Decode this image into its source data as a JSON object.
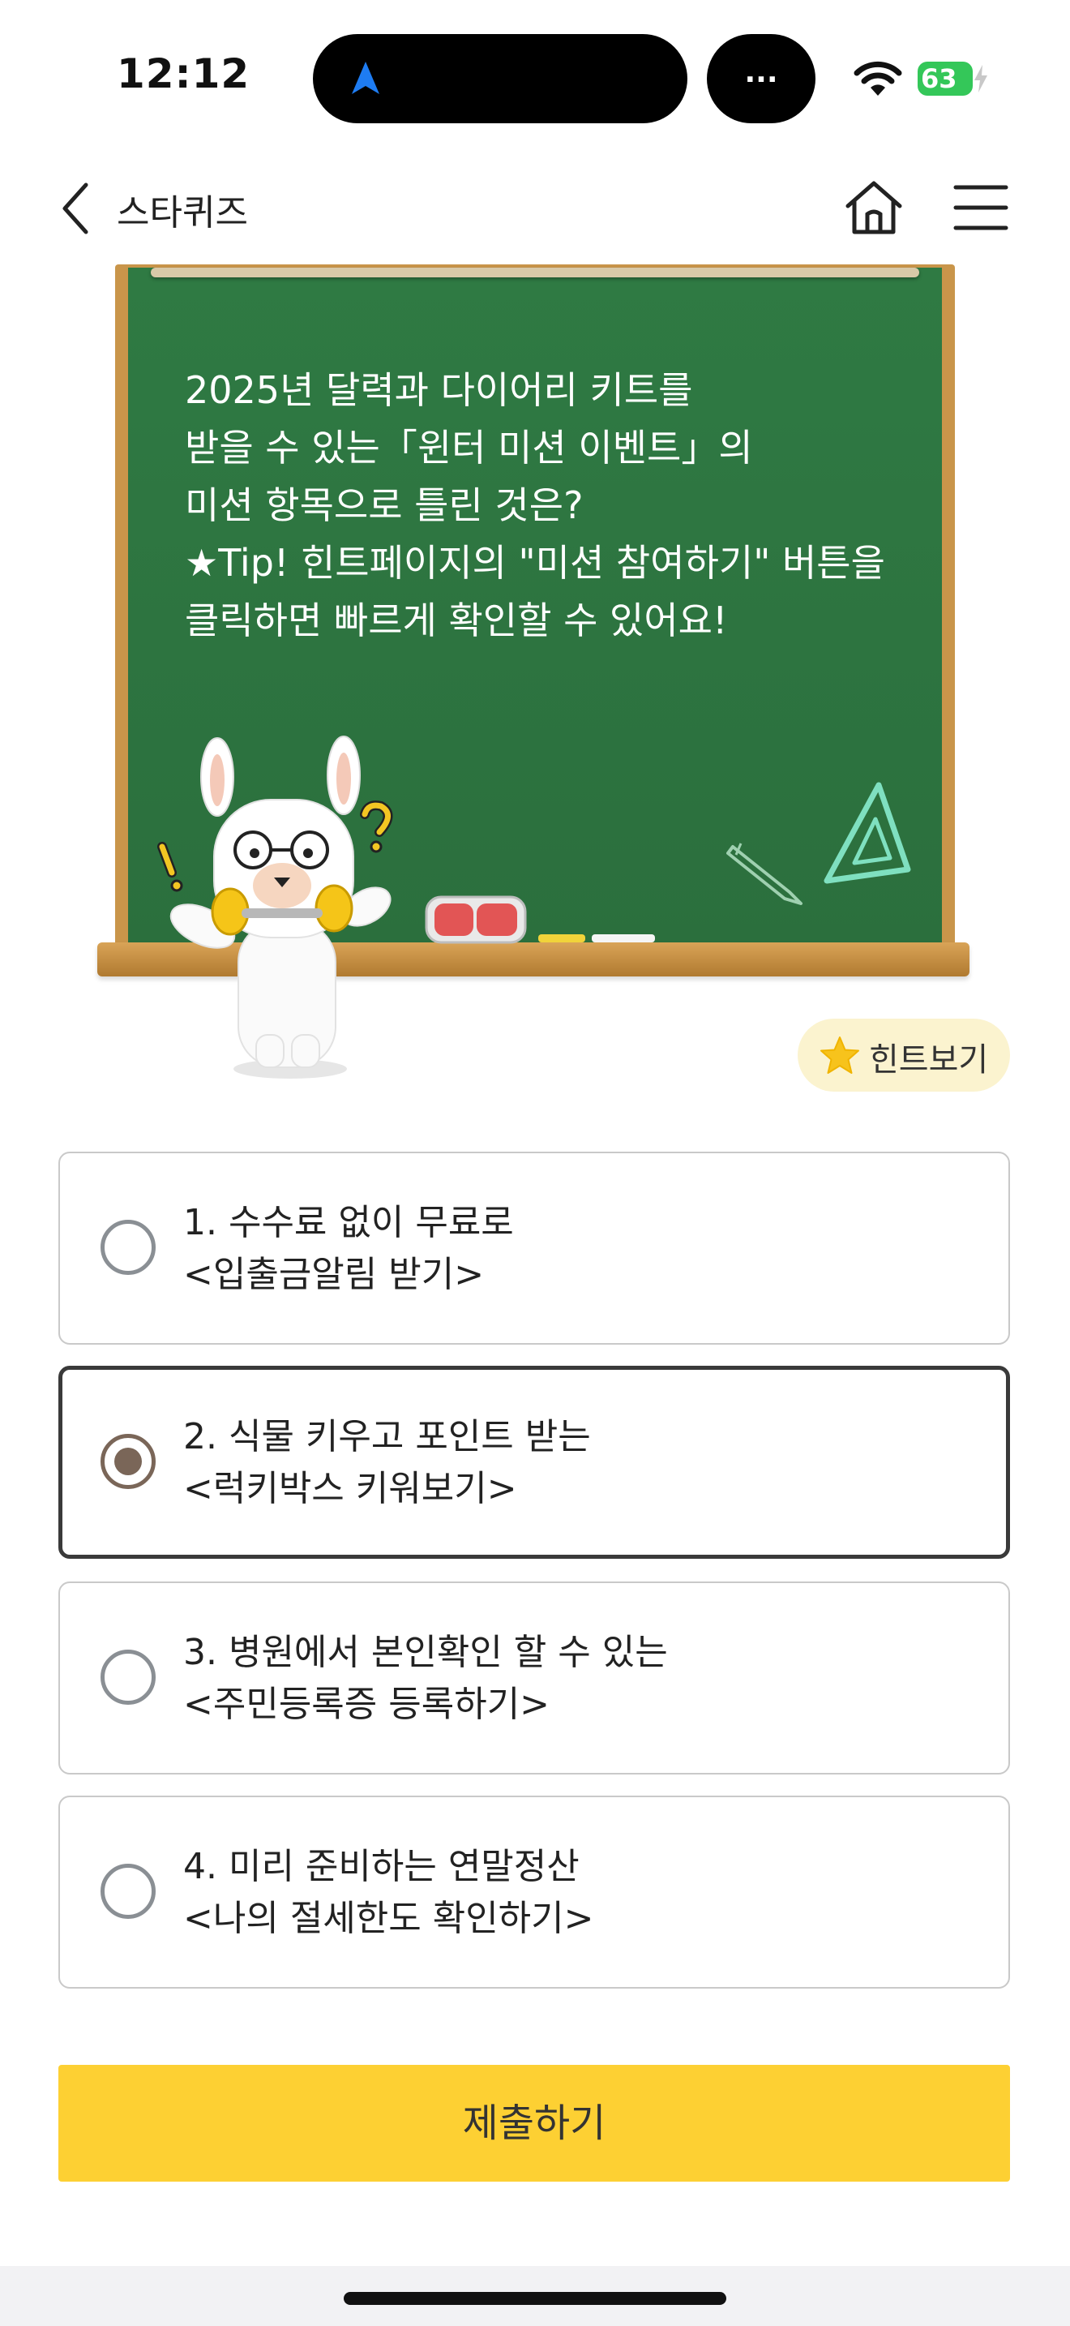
{
  "status_bar": {
    "time": "12:12",
    "more_label": "...",
    "battery": "63",
    "icons": [
      "location-arrow-icon",
      "wifi-icon",
      "battery-charging-icon"
    ]
  },
  "nav": {
    "title": "스타퀴즈",
    "icons": [
      "chevron-left-icon",
      "home-icon",
      "hamburger-menu-icon"
    ]
  },
  "question": {
    "text": "2025년 달력과 다이어리 키트를\n받을 수 있는「윈터 미션 이벤트」의\n미션 항목으로 틀린 것은?\n★Tip! 힌트페이지의 \"미션 참여하기\" 버튼을\n클릭하면 빠르게 확인할 수 있어요!"
  },
  "hint": {
    "label": "힌트보기",
    "icon": "star-icon"
  },
  "options": [
    {
      "text": "1. 수수료 없이 무료로\n<입출금알림 받기>",
      "selected": false
    },
    {
      "text": "2. 식물 키우고 포인트 받는\n<럭키박스 키워보기>",
      "selected": true
    },
    {
      "text": "3. 병원에서 본인확인 할 수 있는\n<주민등록증 등록하기>",
      "selected": false
    },
    {
      "text": "4. 미리 준비하는 연말정산\n<나의 절세한도 확인하기>",
      "selected": false
    }
  ],
  "submit": {
    "label": "제출하기"
  },
  "colors": {
    "board": "#2f7a43",
    "frame": "#c9954a",
    "submit": "#fdd033",
    "hint_bg": "#fbf3cf",
    "selected_radio": "#7a6658",
    "battery": "#34c759"
  }
}
